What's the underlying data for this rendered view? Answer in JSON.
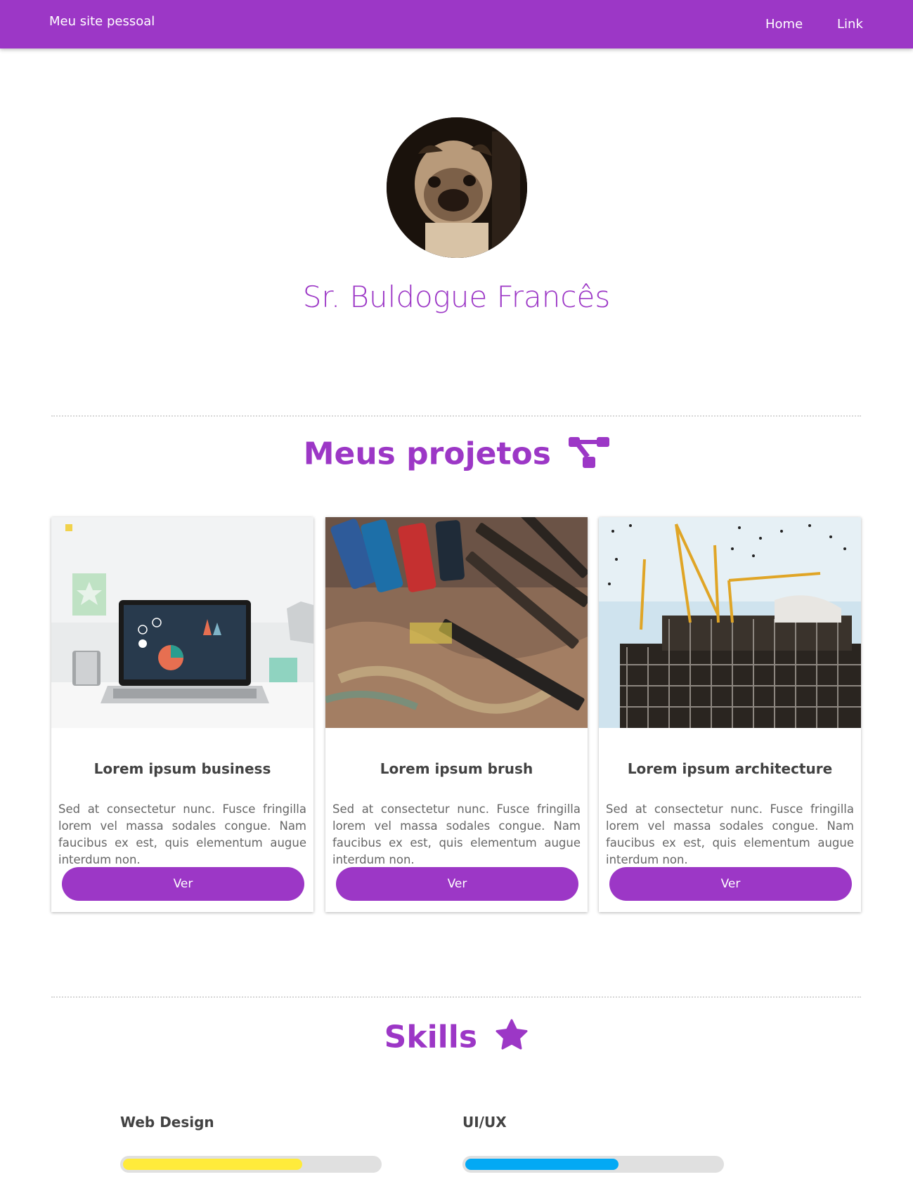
{
  "navbar": {
    "brand": "Meu site pessoal",
    "links": [
      "Home",
      "Link"
    ]
  },
  "profile": {
    "name": "Sr. Buldogue Francês"
  },
  "projects": {
    "title": "Meus projetos",
    "icon": "project-diagram-icon",
    "cards": [
      {
        "title": "Lorem ipsum business",
        "text": "Sed at consectetur nunc. Fusce fringilla lorem vel massa sodales congue. Nam faucibus ex est, quis elementum augue interdum non.",
        "button": "Ver"
      },
      {
        "title": "Lorem ipsum brush",
        "text": "Sed at consectetur nunc. Fusce fringilla lorem vel massa sodales congue. Nam faucibus ex est, quis elementum augue interdum non.",
        "button": "Ver"
      },
      {
        "title": "Lorem ipsum architecture",
        "text": "Sed at consectetur nunc. Fusce fringilla lorem vel massa sodales congue. Nam faucibus ex est, quis elementum augue interdum non.",
        "button": "Ver"
      }
    ]
  },
  "skills": {
    "title": "Skills",
    "icon": "star-icon",
    "items": [
      {
        "label": "Web Design",
        "level": 0.7,
        "color": "#ffeb3b"
      },
      {
        "label": "UI/UX",
        "level": 0.6,
        "color": "#03a9f4"
      }
    ]
  },
  "colors": {
    "accent": "#9c37c6",
    "text": "#424242"
  }
}
